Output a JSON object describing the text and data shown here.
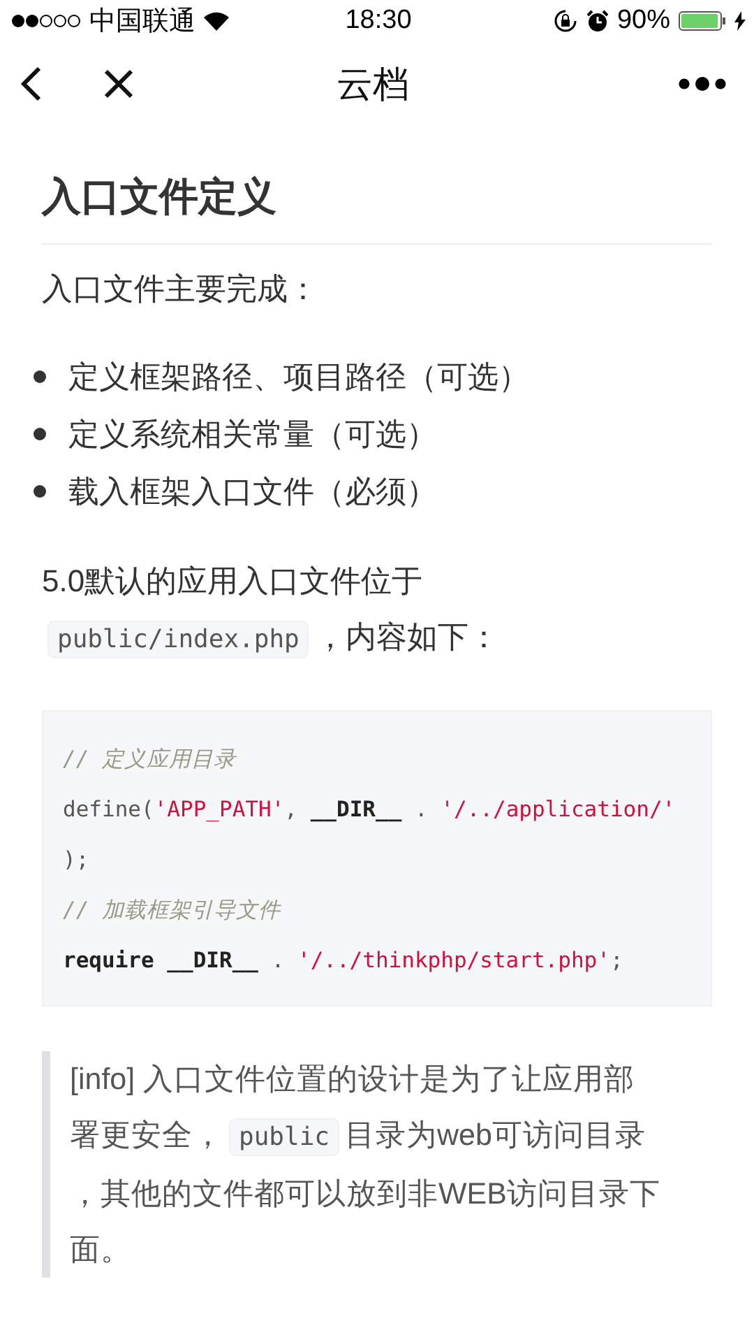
{
  "status_bar": {
    "carrier": "中国联通",
    "time": "18:30",
    "battery": "90%"
  },
  "nav": {
    "title": "云档"
  },
  "article": {
    "heading": "入口文件定义",
    "intro": "入口文件主要完成：",
    "bullets": [
      "定义框架路径、项目路径（可选）",
      "定义系统相关常量（可选）",
      "载入框架入口文件（必须）"
    ],
    "paragraph_lines": [
      [
        {
          "kind": "text",
          "text": "5.0默认的应用入口文件位于"
        }
      ],
      [
        {
          "kind": "code",
          "text": "public/index.php"
        },
        {
          "kind": "text",
          "text": "，内容如下："
        }
      ]
    ],
    "code_lines": [
      [
        {
          "kind": "comment",
          "text": "// 定义应用目录"
        }
      ],
      [
        {
          "kind": "plain",
          "text": "define("
        },
        {
          "kind": "string",
          "text": "'APP_PATH'"
        },
        {
          "kind": "plain",
          "text": ", "
        },
        {
          "kind": "keyword",
          "text": "__DIR__"
        },
        {
          "kind": "plain",
          "text": " . "
        },
        {
          "kind": "string",
          "text": "'/../application/'"
        }
      ],
      [
        {
          "kind": "plain",
          "text": ");"
        }
      ],
      [
        {
          "kind": "comment",
          "text": "// 加载框架引导文件"
        }
      ],
      [
        {
          "kind": "keyword",
          "text": "require"
        },
        {
          "kind": "keyword",
          "text": "__DIR__",
          "space_before": true
        },
        {
          "kind": "plain",
          "text": " . "
        },
        {
          "kind": "string",
          "text": "'/../thinkphp/start.php'"
        },
        {
          "kind": "plain",
          "text": ";"
        }
      ]
    ],
    "quote_lines": [
      [
        {
          "kind": "text",
          "text": "[info] 入口文件位置的设计是为了让应用部"
        }
      ],
      [
        {
          "kind": "text",
          "text": "署更安全，"
        },
        {
          "kind": "code",
          "text": "public"
        },
        {
          "kind": "text",
          "text": "目录为web可访问目录"
        }
      ],
      [
        {
          "kind": "text",
          "text": "，其他的文件都可以放到非WEB访问目录下"
        }
      ],
      [
        {
          "kind": "text",
          "text": "面。"
        }
      ]
    ]
  }
}
